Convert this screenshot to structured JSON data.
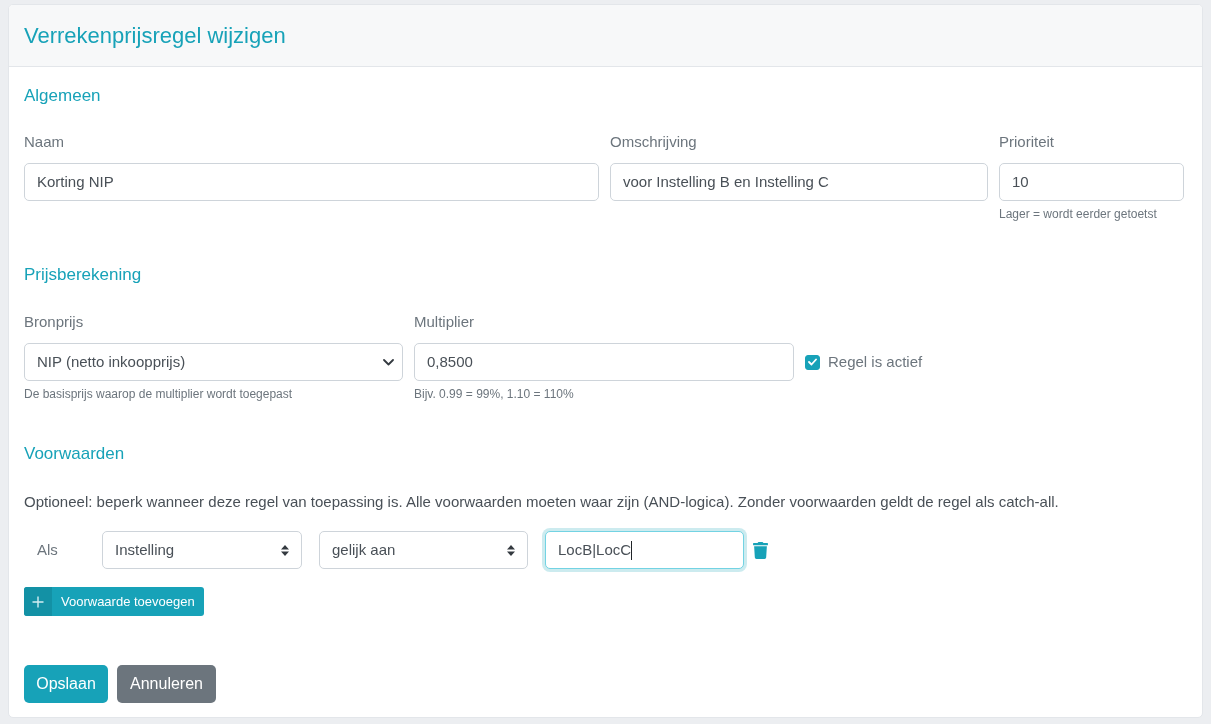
{
  "header": {
    "title": "Verrekenprijsregel wijzigen"
  },
  "general": {
    "heading": "Algemeen",
    "fields": [
      {
        "label": "Naam",
        "value": "Korting NIP"
      },
      {
        "label": "Omschrijving",
        "value": "voor Instelling B en Instelling C"
      },
      {
        "label": "Prioriteit",
        "value": "10",
        "help": "Lager = wordt eerder getoetst"
      }
    ]
  },
  "pricing": {
    "heading": "Prijsberekening",
    "source": {
      "label": "Bronprijs",
      "value": "NIP (netto inkoopprijs)",
      "help": "De basisprijs waarop de multiplier wordt toegepast"
    },
    "multiplier": {
      "label": "Multiplier",
      "value": "0,8500",
      "help": "Bijv. 0.99 = 99%, 1.10 = 110%"
    },
    "active": {
      "label": "Regel is actief",
      "checked": true
    }
  },
  "conditions": {
    "heading": "Voorwaarden",
    "description": "Optioneel: beperk wanneer deze regel van toepassing is. Alle voorwaarden moeten waar zijn (AND-logica). Zonder voorwaarden geldt de regel als catch-all.",
    "rows": [
      {
        "prefix": "Als",
        "field": "Instelling",
        "operator": "gelijk aan",
        "value": "LocB|LocC",
        "focused": true
      }
    ],
    "add_button": "Voorwaarde toevoegen"
  },
  "actions": [
    {
      "label": "Opslaan",
      "kind": "primary"
    },
    {
      "label": "Annuleren",
      "kind": "secondary"
    }
  ]
}
